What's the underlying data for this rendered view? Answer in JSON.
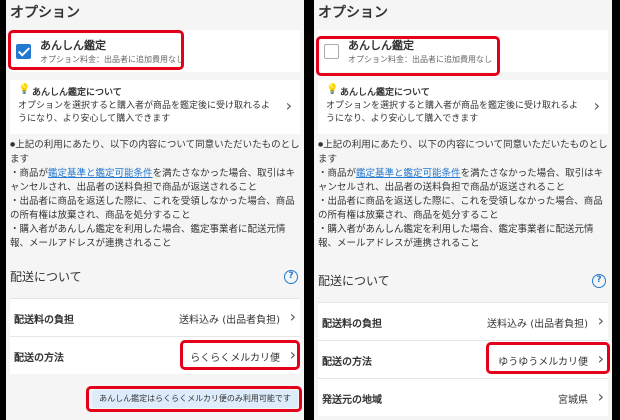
{
  "left": {
    "section_title": "オプション",
    "option": {
      "label": "あんしん鑑定",
      "fee": "オプション料金：出品者に追加費用なし",
      "checked": true
    },
    "about": {
      "title": "あんしん鑑定について",
      "desc": "オプションを選択すると購入者が商品を鑑定後に受け取れるようになり、より安心して購入できます"
    },
    "terms": {
      "intro": "上記の利用にあたり、以下の内容について同意いただいたものとします",
      "item1_prefix": "・商品が",
      "item1_link1": "鑑定基準",
      "item1_and": "と",
      "item1_link2": "鑑定可能条件",
      "item1_suffix": "を満たさなかった場合、取引はキャンセルされ、出品者の送料負担で商品が返送されること",
      "item2": "・出品者に商品を返送した際に、これを受領しなかった場合、商品の所有権は放棄され、商品を処分すること",
      "item3": "・購入者があんしん鑑定を利用した場合、鑑定事業者に配送元情報、メールアドレスが連携されること"
    },
    "shipping_title": "配送について",
    "help_icon_text": "?",
    "rows": [
      {
        "label": "配送料の負担",
        "value": "送料込み (出品者負担)"
      },
      {
        "label": "配送の方法",
        "value": "らくらくメルカリ便"
      }
    ],
    "notice": "あんしん鑑定はらくらくメルカリ便のみ利用可能です"
  },
  "right": {
    "section_title": "オプション",
    "option": {
      "label": "あんしん鑑定",
      "fee": "オプション料金：出品者に追加費用なし",
      "checked": false
    },
    "about": {
      "title": "あんしん鑑定について",
      "desc": "オプションを選択すると購入者が商品を鑑定後に受け取れるようになり、より安心して購入できます"
    },
    "terms": {
      "intro": "上記の利用にあたり、以下の内容について同意いただいたものとします",
      "item1_prefix": "・商品が",
      "item1_link1": "鑑定基準",
      "item1_and": "と",
      "item1_link2": "鑑定可能条件",
      "item1_suffix": "を満たさなかった場合、取引はキャンセルされ、出品者の送料負担で商品が返送されること",
      "item2": "・出品者に商品を返送した際に、これを受領しなかった場合、商品の所有権は放棄され、商品を処分すること",
      "item3": "・購入者があんしん鑑定を利用した場合、鑑定事業者に配送元情報、メールアドレスが連携されること"
    },
    "shipping_title": "配送について",
    "help_icon_text": "?",
    "rows": [
      {
        "label": "配送料の負担",
        "value": "送料込み (出品者負担)"
      },
      {
        "label": "配送の方法",
        "value": "ゆうゆうメルカリ便"
      },
      {
        "label": "発送元の地域",
        "value": "宮城県"
      }
    ]
  },
  "glyphs": {
    "chevron": "›",
    "bullet": "●",
    "lightbulb": "💡"
  },
  "colors": {
    "accent": "#2378d0",
    "highlight": "#e4001b",
    "notice_bg": "#dcecfa"
  }
}
